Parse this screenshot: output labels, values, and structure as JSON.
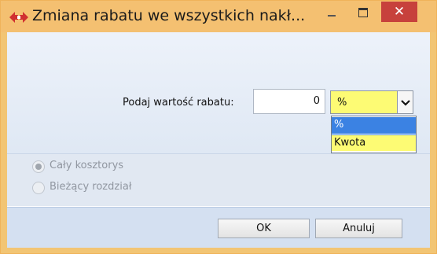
{
  "window": {
    "title": "Zmiana rabatu we wszystkich nakł...",
    "close_glyph": "✕",
    "icon": "app-diamond-arrows-icon"
  },
  "form": {
    "discount_label": "Podaj wartość rabatu:",
    "discount_value": "0",
    "unit_selected": "%",
    "unit_options": [
      "%",
      "Kwota"
    ]
  },
  "scope": {
    "option_whole": "Cały kosztorys",
    "option_current": "Bieżący rozdział",
    "selected": "Cały kosztorys"
  },
  "buttons": {
    "ok": "OK",
    "cancel": "Anuluj"
  },
  "colors": {
    "titlebar": "#f4c071",
    "close": "#c7413c",
    "highlight_yellow": "#fdfb74",
    "selection_blue": "#3b82e3"
  }
}
